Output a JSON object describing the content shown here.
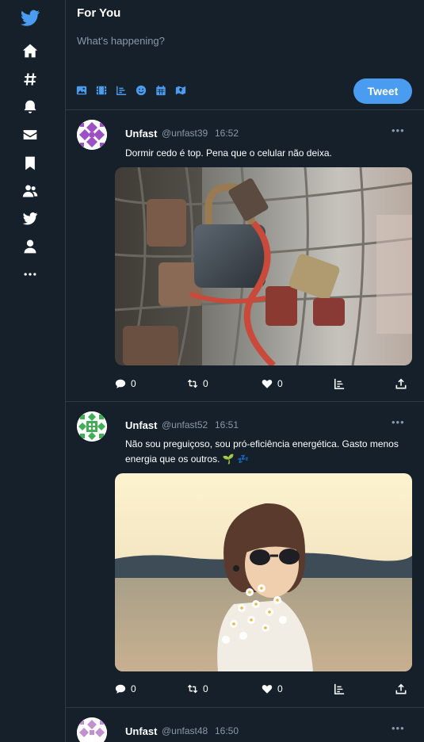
{
  "header": {
    "title": "For You"
  },
  "compose": {
    "placeholder": "What's happening?",
    "tweet_button": "Tweet",
    "tools": [
      "image-icon",
      "gif-icon",
      "poll-icon",
      "emoji-icon",
      "schedule-icon",
      "location-icon"
    ]
  },
  "sidebar": {
    "items": [
      "twitter-logo-icon",
      "home-icon",
      "hashtag-icon",
      "notifications-icon",
      "messages-icon",
      "bookmark-icon",
      "communities-icon",
      "twitter-bird-icon",
      "profile-icon",
      "more-icon"
    ]
  },
  "colors": {
    "accent": "#4a9cf0",
    "background": "#15202b",
    "muted": "#8b98a5"
  },
  "tweets": [
    {
      "name": "Unfast",
      "handle": "@unfast39",
      "time": "16:52",
      "text": "Dormir cedo é top. Pena que o celular não deixa.",
      "image": "padlocks-on-fence-photo",
      "replies": "0",
      "retweets": "0",
      "likes": "0"
    },
    {
      "name": "Unfast",
      "handle": "@unfast52",
      "time": "16:51",
      "text": "Não sou preguiçoso, sou pró-eficiência energética. Gasto menos energia que os outros. 🌱 💤",
      "image": "woman-with-sunglasses-and-flowers-photo",
      "replies": "0",
      "retweets": "0",
      "likes": "0"
    },
    {
      "name": "Unfast",
      "handle": "@unfast48",
      "time": "16:50"
    }
  ]
}
